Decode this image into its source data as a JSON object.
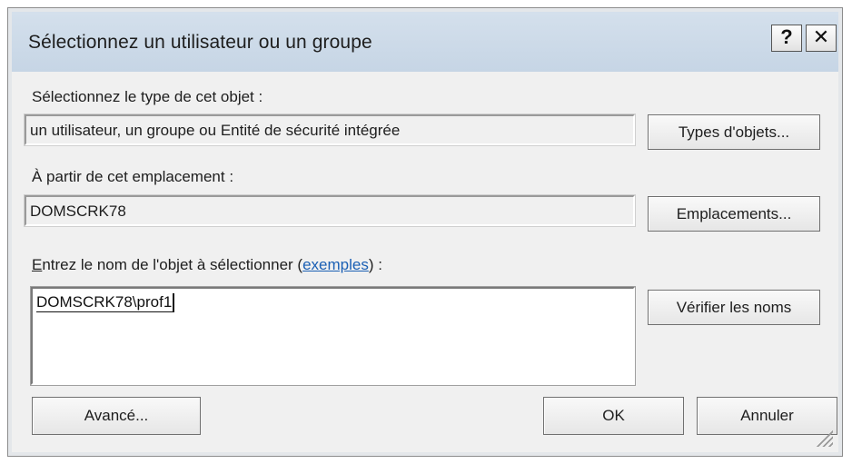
{
  "window": {
    "title": "Sélectionnez un utilisateur ou un groupe",
    "help_glyph": "?",
    "close_glyph": "✕"
  },
  "object_type": {
    "label": "Sélectionnez le type de cet objet :",
    "value": "un utilisateur, un groupe ou Entité de sécurité intégrée",
    "button": "Types d'objets..."
  },
  "location": {
    "label": "À partir de cet emplacement :",
    "value": "DOMSCRK78",
    "button": "Emplacements..."
  },
  "object_name": {
    "label_first_letter": "E",
    "label_before_link": "ntrez le nom de l'objet à sélectionner (",
    "link": "exemples",
    "label_after_link": ") :",
    "value": "DOMSCRK78\\prof1",
    "check_button": "Vérifier les noms"
  },
  "footer": {
    "advanced_button": "Avancé...",
    "ok_button": "OK",
    "cancel_button": "Annuler"
  }
}
